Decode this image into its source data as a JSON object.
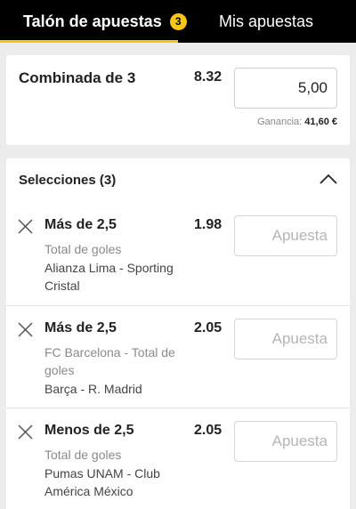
{
  "tabs": {
    "betslip_label": "Talón de apuestas",
    "betslip_count": "3",
    "mybets_label": "Mis apuestas"
  },
  "combo": {
    "title": "Combinada de 3",
    "odds": "8.32",
    "stake": "5,00",
    "winnings_label": "Ganancia:",
    "winnings_value": "41,60 €"
  },
  "selections": {
    "header": "Selecciones (3)",
    "items": [
      {
        "name": "Más de 2,5",
        "odds": "1.98",
        "market": "Total de goles",
        "event": "Alianza Lima - Sporting Cristal",
        "placeholder": "Apuesta"
      },
      {
        "name": "Más de 2,5",
        "odds": "2.05",
        "market": "FC Barcelona - Total de goles",
        "event": "Barça - R. Madrid",
        "placeholder": "Apuesta"
      },
      {
        "name": "Menos de 2,5",
        "odds": "2.05",
        "market": "Total de goles",
        "event": "Pumas UNAM - Club América México",
        "placeholder": "Apuesta"
      }
    ]
  },
  "colors": {
    "accent": "#f5c518",
    "tabbar": "#000000",
    "background": "#ececec"
  },
  "icons": {
    "collapse": "chevron-up-icon",
    "remove": "close-icon"
  }
}
